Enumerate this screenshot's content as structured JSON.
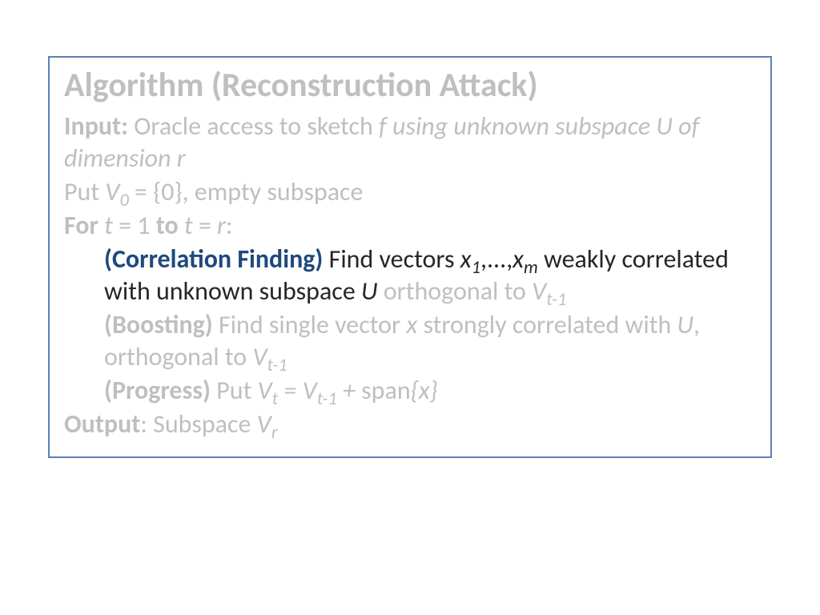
{
  "title": "Algorithm (Reconstruction Attack)",
  "input_label": "Input:",
  "input_text_1": " Oracle access to sketch ",
  "input_f": "f using unknown subspace U of dimension r",
  "put_1": "Put ",
  "V0_v": "V",
  "V0_sub": "0",
  "put_2": " = {0}, empty subspace",
  "for_1": "For",
  "for_t1": " t",
  "for_eq1": " = 1 ",
  "for_to": "to",
  "for_t2": " t",
  "for_eq2": " = ",
  "for_r": "r",
  "for_colon": ":",
  "cf_label": "(Correlation Finding)",
  "cf_find": " Find vectors ",
  "cf_x": "x",
  "cf_sub1": "1",
  "cf_dots": ",...,",
  "cf_xm": "x",
  "cf_subm": "m",
  "cf_weak": " weakly correlated with unknown subspace ",
  "cf_U": "U",
  "cf_orth": " orthogonal to ",
  "cf_V": "V",
  "cf_t1": "t-1",
  "bo_label": "(Boosting)",
  "bo_find": " Find single vector ",
  "bo_x": "x",
  "bo_strong": " strongly correlated with ",
  "bo_U": "U",
  "bo_orth": ", orthogonal to ",
  "bo_V": "V",
  "bo_t1": "t-1",
  "pr_label": "(Progress)",
  "pr_put": " Put ",
  "pr_V": "V",
  "pr_t": "t",
  "pr_eq": " = ",
  "pr_V2": "V",
  "pr_t1": "t-1",
  "pr_plus": " + ",
  "pr_span": "span",
  "pr_braces": "{x}",
  "out_label": "Output",
  "out_colon": ": Subspace ",
  "out_V": "V",
  "out_r": "r"
}
